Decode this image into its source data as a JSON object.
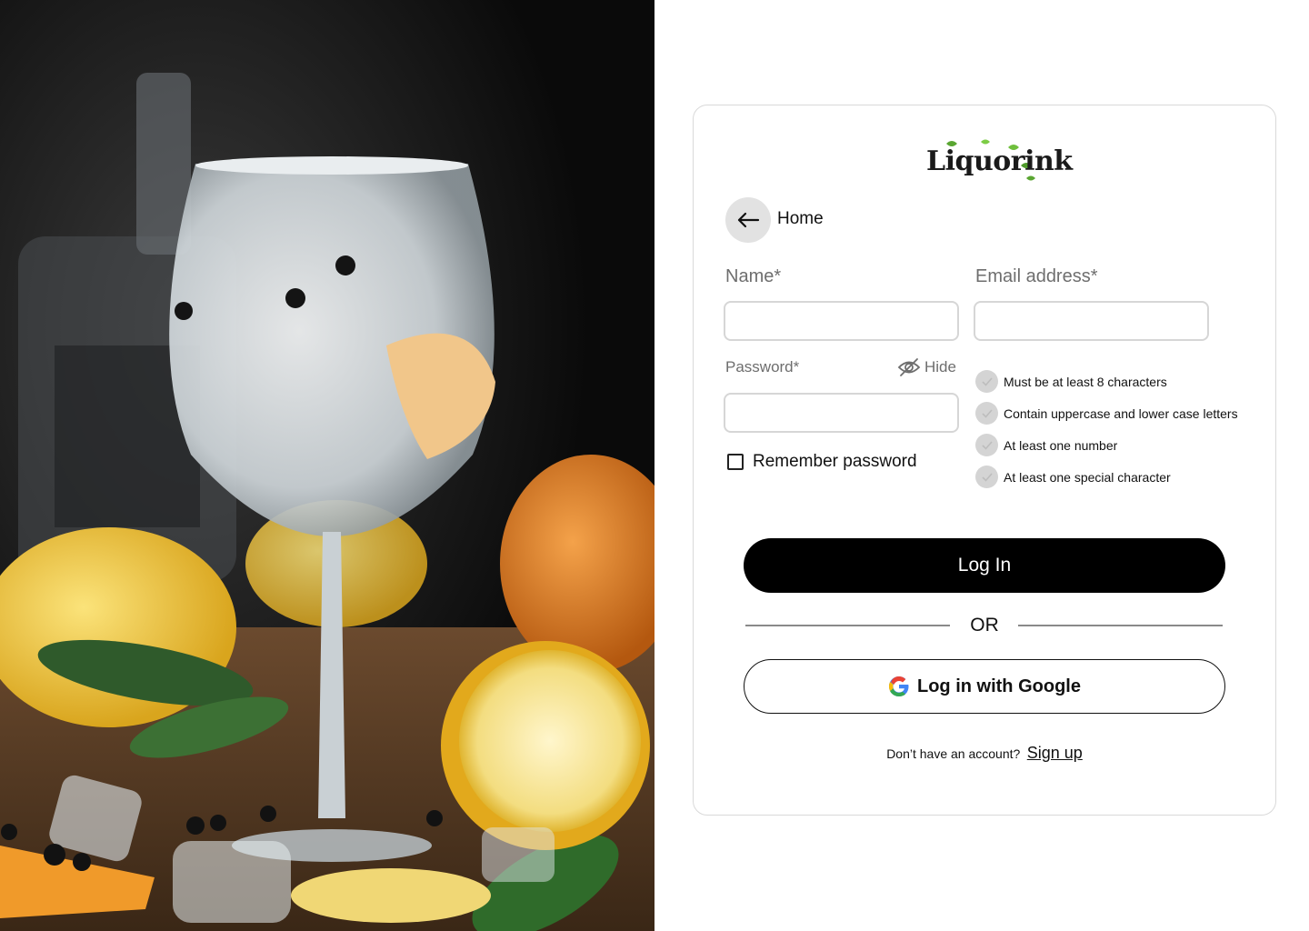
{
  "hero": {
    "image": "gin-tonic-glass-with-lemons-photo"
  },
  "brand": {
    "logo_text": "Liquorink"
  },
  "nav": {
    "back_label": "Home",
    "back_icon": "arrow-left-icon"
  },
  "form": {
    "name_label": "Name*",
    "name_value": "",
    "email_label": "Email address*",
    "email_value": "",
    "password_label": "Password*",
    "password_value": "",
    "hide_label": "Hide",
    "hide_icon": "eye-off-icon",
    "remember_label": "Remember password",
    "remember_checked": false
  },
  "password_rules": [
    {
      "text": "Must be at least 8 characters",
      "met": false
    },
    {
      "text": "Contain uppercase and lower case letters",
      "met": false
    },
    {
      "text": "At least one number",
      "met": false
    },
    {
      "text": "At least one special character",
      "met": false
    }
  ],
  "actions": {
    "login_label": "Log In",
    "or_label": "OR",
    "google_label": "Log in with Google",
    "google_icon": "google-g-icon"
  },
  "signup": {
    "prompt": "Don’t have an account?",
    "link_label": "Sign up"
  },
  "colors": {
    "primary_button": "#000000",
    "rule_unmet": "#d4d4d4",
    "back_button_bg": "#e2e2e2",
    "google_blue": "#4285F4",
    "google_red": "#EA4335",
    "google_yellow": "#FBBC05",
    "google_green": "#34A853"
  }
}
